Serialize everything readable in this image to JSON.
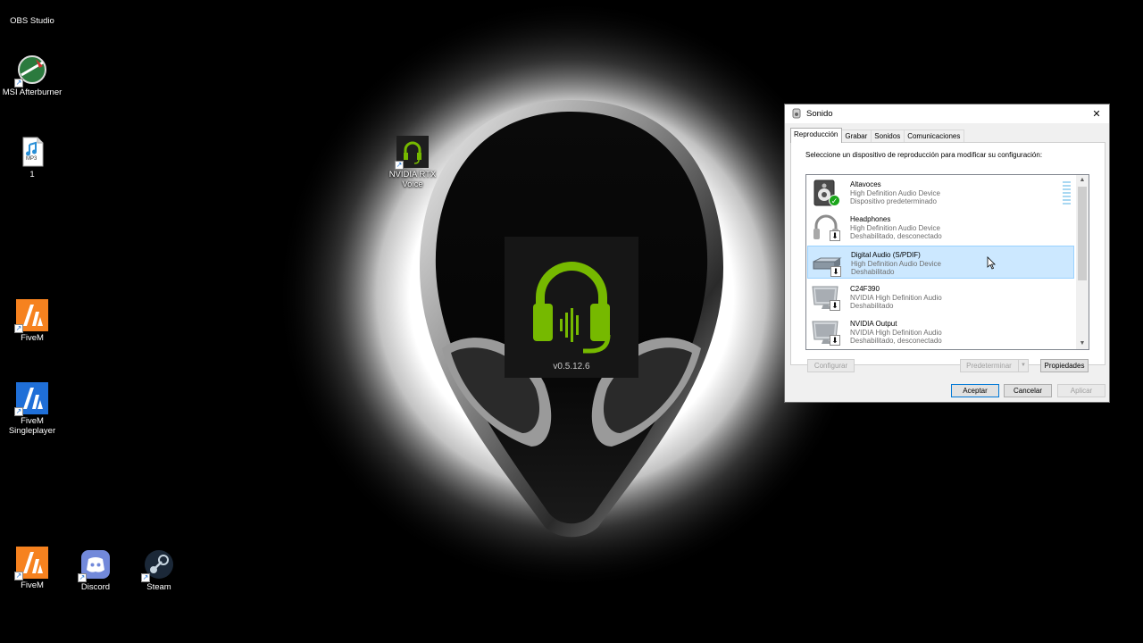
{
  "desktop": {
    "icons": [
      {
        "label": "OBS Studio",
        "icon": "obs-icon"
      },
      {
        "label": "MSI Afterburner",
        "icon": "msi-afterburner-icon"
      },
      {
        "label": "1",
        "icon": "mp3-file-icon"
      },
      {
        "label": "NVIDIA RTX Voice",
        "icon": "nvidia-rtx-voice-icon"
      },
      {
        "label": "FiveM",
        "icon": "fivem-icon"
      },
      {
        "label": "FiveM Singleplayer",
        "icon": "fivem-singleplayer-icon"
      },
      {
        "label": "FiveM",
        "icon": "fivem-icon"
      },
      {
        "label": "Discord",
        "icon": "discord-icon"
      },
      {
        "label": "Steam",
        "icon": "steam-icon"
      }
    ],
    "mp3_badge": "MP3"
  },
  "splash": {
    "version": "v0.5.12.6",
    "accent_color": "#76b900"
  },
  "dialog": {
    "title": "Sonido",
    "close_glyph": "✕",
    "tabs": [
      {
        "label": "Reproducción",
        "active": true
      },
      {
        "label": "Grabar",
        "active": false
      },
      {
        "label": "Sonidos",
        "active": false
      },
      {
        "label": "Comunicaciones",
        "active": false
      }
    ],
    "instruction": "Seleccione un dispositivo de reproducción para modificar su configuración:",
    "devices": [
      {
        "name": "Altavoces",
        "driver": "High Definition Audio Device",
        "status": "Dispositivo predeterminado",
        "icon": "speaker-icon",
        "badge": "default-check-badge",
        "selected": false
      },
      {
        "name": "Headphones",
        "driver": "High Definition Audio Device",
        "status": "Deshabilitado, desconectado",
        "icon": "headphones-icon",
        "badge": "disabled-arrow-badge",
        "selected": false
      },
      {
        "name": "Digital Audio (S/PDIF)",
        "driver": "High Definition Audio Device",
        "status": "Deshabilitado",
        "icon": "digital-audio-icon",
        "badge": "disabled-arrow-badge",
        "selected": true
      },
      {
        "name": "C24F390",
        "driver": "NVIDIA High Definition Audio",
        "status": "Deshabilitado",
        "icon": "monitor-icon",
        "badge": "disabled-arrow-badge",
        "selected": false
      },
      {
        "name": "NVIDIA Output",
        "driver": "NVIDIA High Definition Audio",
        "status": "Deshabilitado, desconectado",
        "icon": "monitor-icon",
        "badge": "disabled-arrow-badge",
        "selected": false
      }
    ],
    "buttons": {
      "configure": "Configurar",
      "set_default": "Predeterminar",
      "properties": "Propiedades",
      "ok": "Aceptar",
      "cancel": "Cancelar",
      "apply": "Aplicar"
    },
    "colors": {
      "selection_bg": "#cce8ff",
      "selection_border": "#99d1ff",
      "primary_border": "#0078d7"
    }
  }
}
